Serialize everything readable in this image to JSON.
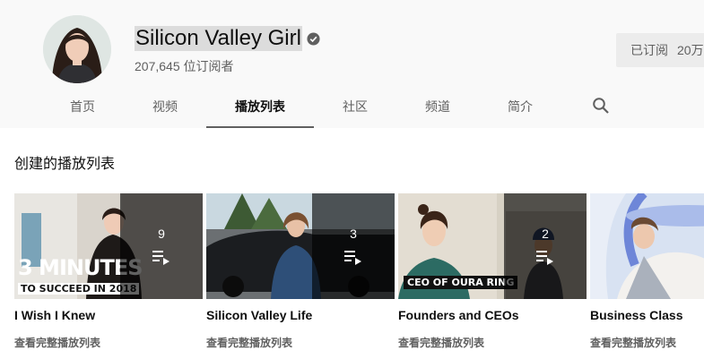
{
  "channel": {
    "name": "Silicon Valley Girl",
    "subscribers": "207,645 位订阅者",
    "subscribed_label": "已订阅",
    "subscribed_count": "20万"
  },
  "tabs": [
    {
      "label": "首页",
      "active": false
    },
    {
      "label": "视频",
      "active": false
    },
    {
      "label": "播放列表",
      "active": true
    },
    {
      "label": "社区",
      "active": false
    },
    {
      "label": "频道",
      "active": false
    },
    {
      "label": "简介",
      "active": false
    }
  ],
  "section": {
    "title": "创建的播放列表"
  },
  "playlists": [
    {
      "title": "I Wish I Knew",
      "count": "9",
      "link": "查看完整播放列表",
      "thumb_text_1": "3 MINUTES",
      "thumb_text_2": "TO SUCCEED IN 2018"
    },
    {
      "title": "Silicon Valley Life",
      "count": "3",
      "link": "查看完整播放列表"
    },
    {
      "title": "Founders and CEOs",
      "count": "2",
      "link": "查看完整播放列表",
      "thumb_text_1": "CEO OF OURA RING"
    },
    {
      "title": "Business Class",
      "count": "",
      "link": "查看完整播放列表"
    }
  ],
  "icons": {
    "verified": "verified-check-icon",
    "search": "search-icon",
    "playlist": "playlist-icon"
  },
  "colors": {
    "header_bg": "#f9f9f9",
    "muted_text": "#606060",
    "active_tab_underline": "#606060"
  }
}
